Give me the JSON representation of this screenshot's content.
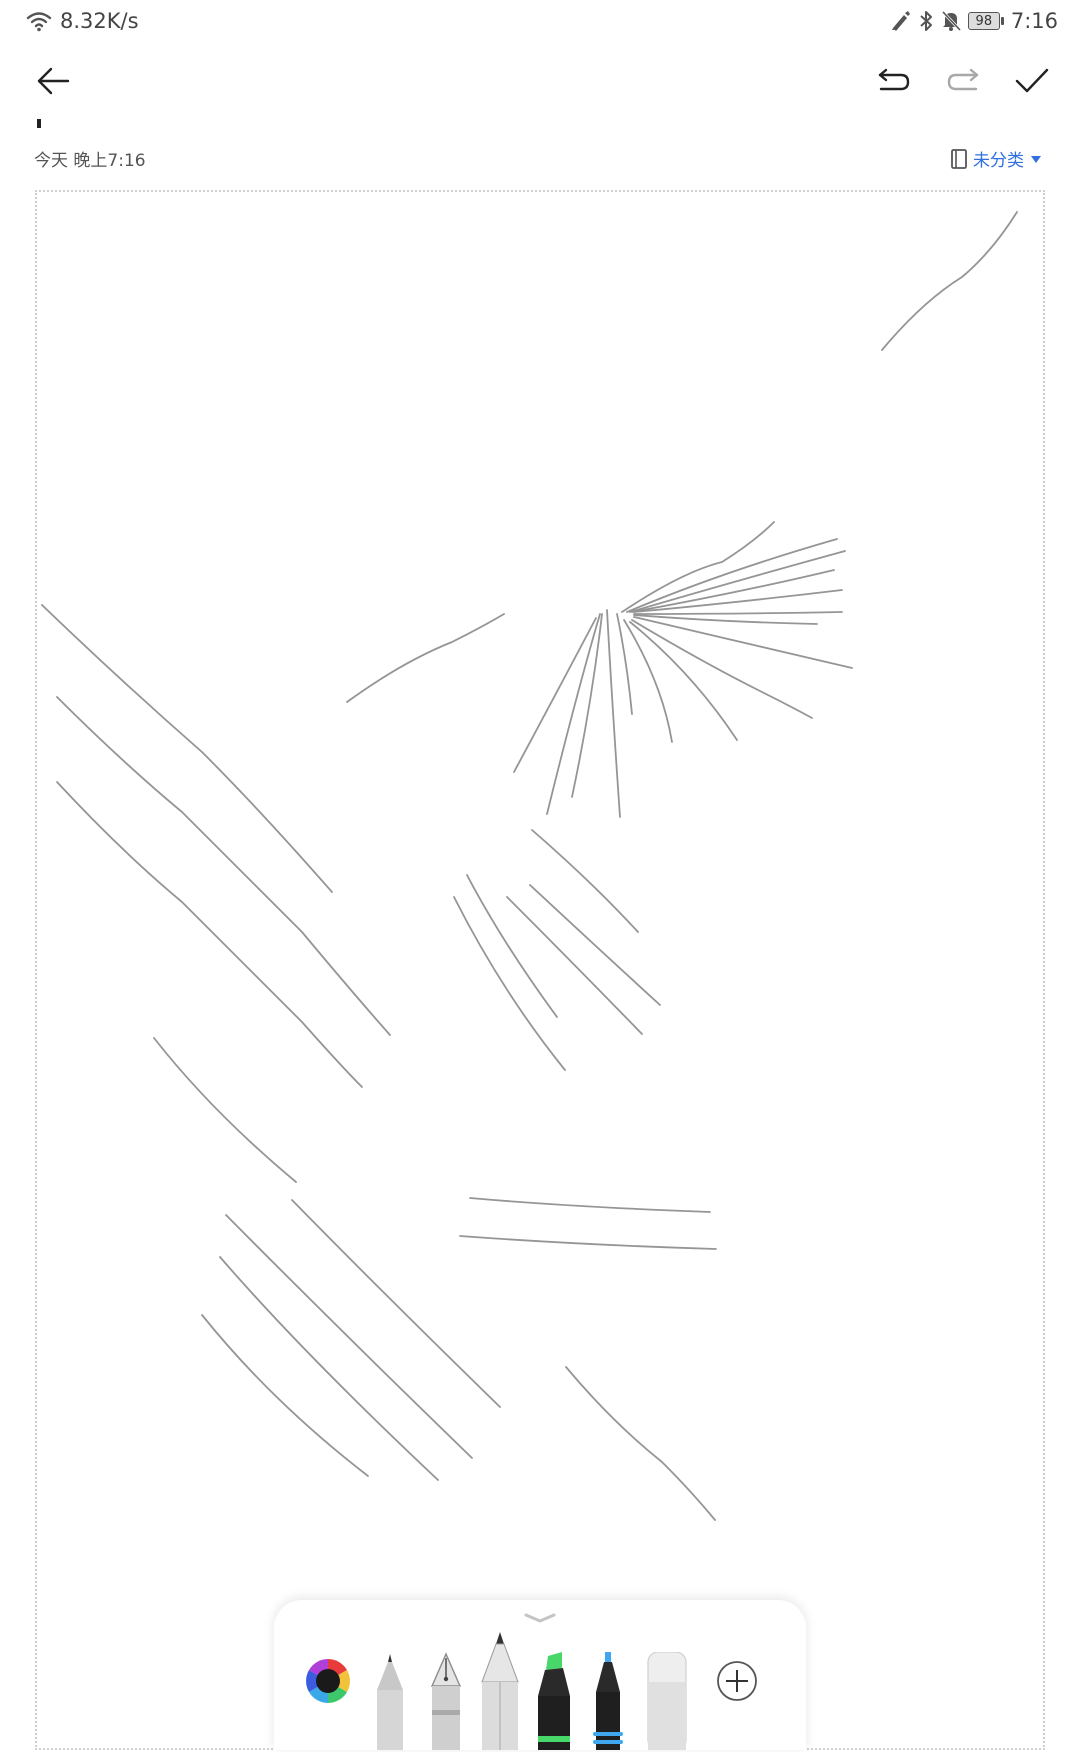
{
  "status_bar": {
    "network_speed": "8.32K/s",
    "battery_level": "98",
    "time": "7:16",
    "icons": [
      "wifi-icon",
      "stylus-icon",
      "bluetooth-icon",
      "bell-muted-icon",
      "battery-icon"
    ]
  },
  "toolbar": {
    "icons": [
      "back-arrow-icon",
      "undo-icon",
      "redo-icon",
      "check-icon"
    ]
  },
  "note": {
    "date_label": "今天 晚上7:16",
    "category_label": "未分类",
    "category_icons": [
      "notebook-icon",
      "dropdown-triangle-icon"
    ]
  },
  "pen_panel": {
    "tools": [
      "color-wheel",
      "ballpoint-pen",
      "fountain-pen",
      "pencil",
      "marker",
      "fineliner",
      "eraser",
      "add-tool"
    ],
    "selected_tool": "pencil",
    "colors": {
      "accent": "#2f6fe0",
      "marker": "#48d86a",
      "fineliner": "#3fa6f0",
      "stroke": "#8a8a8a"
    }
  }
}
